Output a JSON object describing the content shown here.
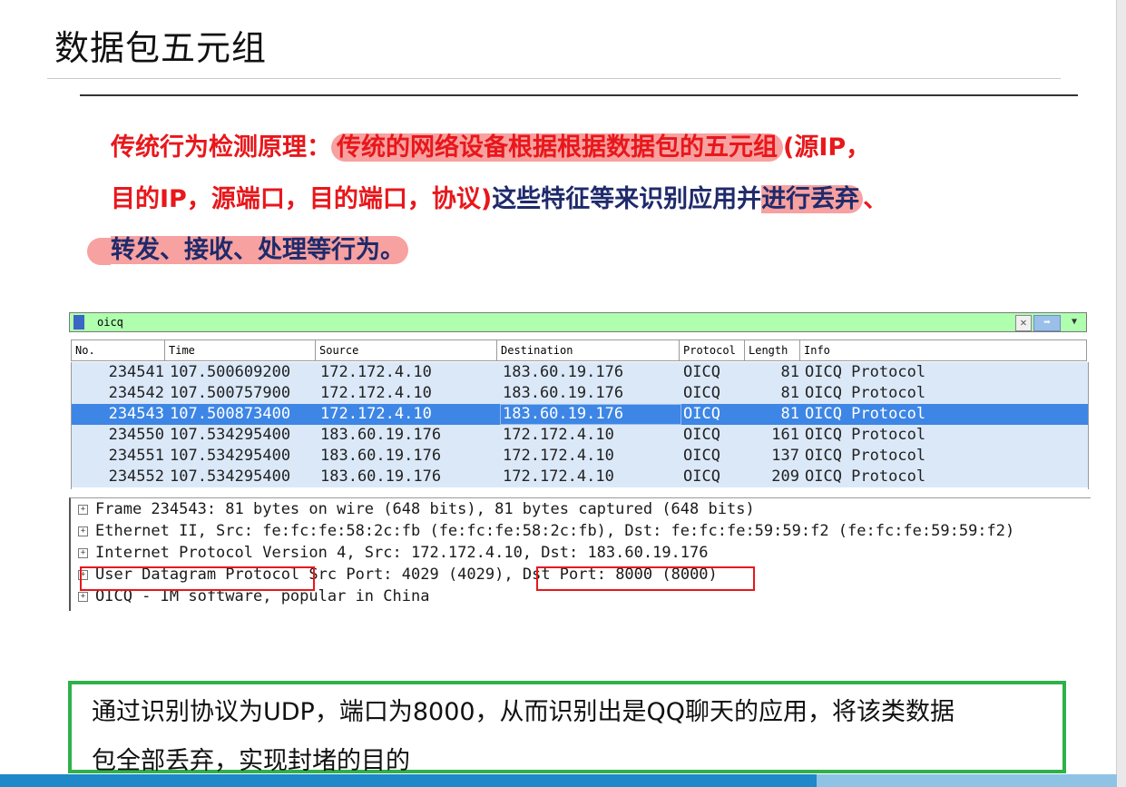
{
  "slide": {
    "title": "数据包五元组"
  },
  "paragraph": {
    "line1_label": "传统行为检测原理：",
    "line1_highlight": "传统的网络设备根据根据数据包的五元组",
    "line1_tail": "(源IP，",
    "line2_red": "目的IP，源端口，目的端口，协议)",
    "line2_navy": "这些特征等来识别应用并",
    "line2_highlight": "进行丢弃",
    "line2_end": "、",
    "line3_highlight": "转发、接收、处理等行为。"
  },
  "wireshark": {
    "filter_value": "oicq",
    "columns": [
      "No.",
      "Time",
      "Source",
      "Destination",
      "Protocol",
      "Length",
      "Info"
    ],
    "packets": [
      {
        "no": "234541",
        "time": "107.500609200",
        "src": "172.172.4.10",
        "dst": "183.60.19.176",
        "proto": "OICQ",
        "len": "81",
        "info": "OICQ Protocol"
      },
      {
        "no": "234542",
        "time": "107.500757900",
        "src": "172.172.4.10",
        "dst": "183.60.19.176",
        "proto": "OICQ",
        "len": "81",
        "info": "OICQ Protocol"
      },
      {
        "no": "234543",
        "time": "107.500873400",
        "src": "172.172.4.10",
        "dst": "183.60.19.176",
        "proto": "OICQ",
        "len": "81",
        "info": "OICQ Protocol"
      },
      {
        "no": "234550",
        "time": "107.534295400",
        "src": "183.60.19.176",
        "dst": "172.172.4.10",
        "proto": "OICQ",
        "len": "161",
        "info": "OICQ Protocol"
      },
      {
        "no": "234551",
        "time": "107.534295400",
        "src": "183.60.19.176",
        "dst": "172.172.4.10",
        "proto": "OICQ",
        "len": "137",
        "info": "OICQ Protocol"
      },
      {
        "no": "234552",
        "time": "107.534295400",
        "src": "183.60.19.176",
        "dst": "172.172.4.10",
        "proto": "OICQ",
        "len": "209",
        "info": "OICQ Protocol"
      }
    ],
    "details": {
      "frame": "Frame 234543: 81 bytes on wire (648 bits), 81 bytes captured (648 bits)",
      "ethernet": "Ethernet II, Src: fe:fc:fe:58:2c:fb (fe:fc:fe:58:2c:fb), Dst: fe:fc:fe:59:59:f2 (fe:fc:fe:59:59:f2)",
      "ip": "Internet Protocol Version 4, Src: 172.172.4.10, Dst: 183.60.19.176",
      "udp_name": "User Datagram Protocol",
      "udp_src": "Src Port: 4029 (4029),",
      "udp_dst": "Dst Port: 8000 (8000)",
      "oicq": "OICQ - IM software, popular in China"
    }
  },
  "note": {
    "line1": "通过识别协议为UDP，端口为8000，从而识别出是QQ聊天的应用，将该类数据",
    "line2": "包全部丢弃，实现封堵的目的"
  }
}
